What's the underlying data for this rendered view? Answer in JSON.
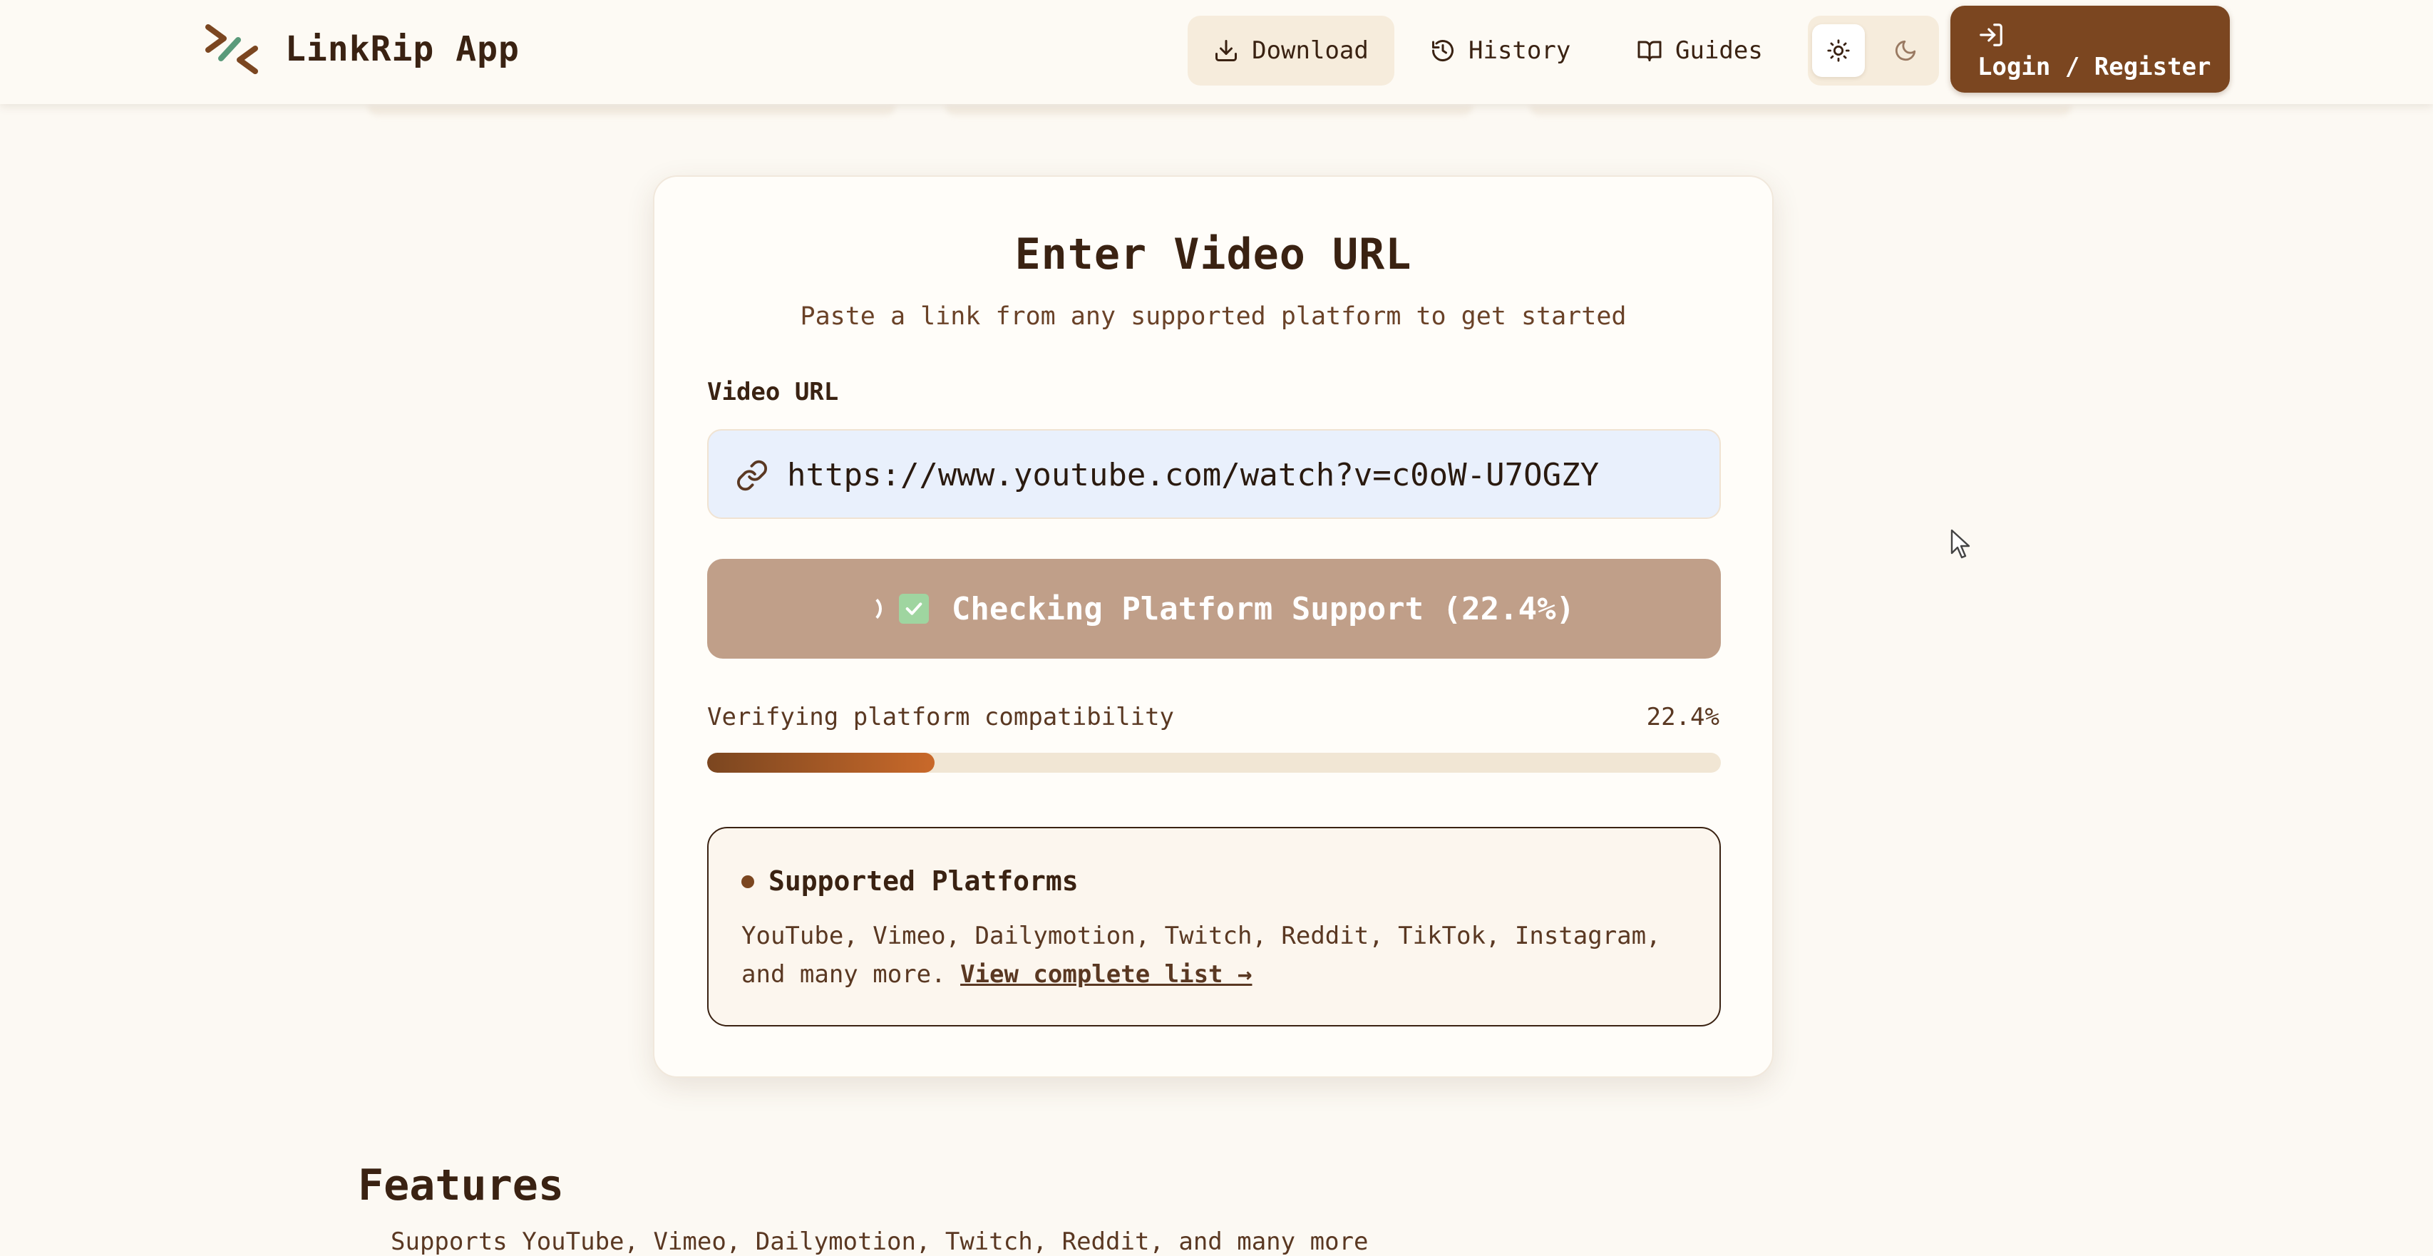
{
  "app": {
    "name": "LinkRip App"
  },
  "nav": {
    "download": "Download",
    "history": "History",
    "guides": "Guides",
    "login": "Login / Register"
  },
  "theme": {
    "light_icon": "sun-icon",
    "dark_icon": "moon-icon",
    "selected": "light"
  },
  "card": {
    "title": "Enter Video URL",
    "subtitle": "Paste a link from any supported platform to get started",
    "field_label": "Video URL",
    "url_value": "https://www.youtube.com/watch?v=c0oW-U7OGZY",
    "button_label": "Checking Platform Support (22.4%)",
    "progress_label": "Verifying platform compatibility",
    "progress_text": "22.4%",
    "progress_fraction": 0.224
  },
  "platforms": {
    "title": "Supported Platforms",
    "text": "YouTube, Vimeo, Dailymotion, Twitch, Reddit, TikTok, Instagram, and many more.",
    "link": "View complete list →"
  },
  "features": {
    "title": "Features",
    "first_item": "Supports YouTube, Vimeo, Dailymotion, Twitch, Reddit, and many more"
  },
  "colors": {
    "accent": "#7b4620",
    "background": "#fcf9f3",
    "button_disabled": "#c09f89",
    "input_bg": "#e9f0fc"
  }
}
